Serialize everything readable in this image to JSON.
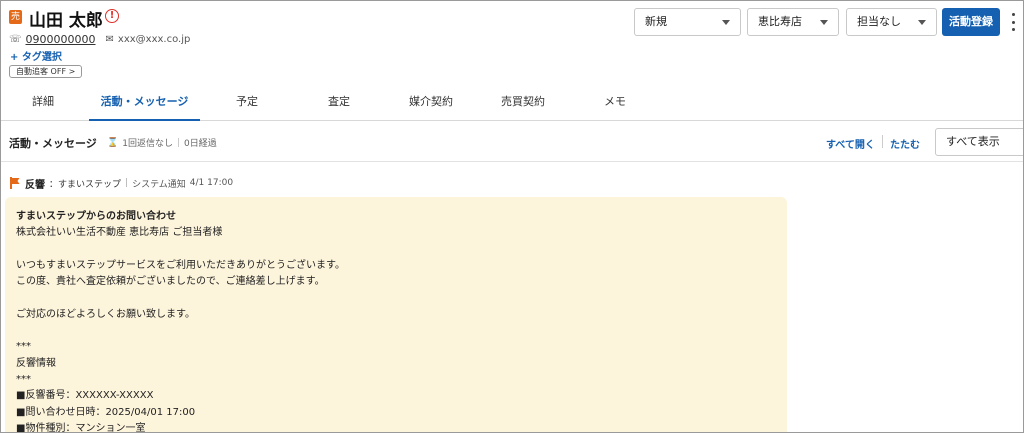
{
  "customer": {
    "badge": "売",
    "name": "山田 太郎",
    "alert_glyph": "!",
    "phone": "0900000000",
    "email": "xxx@xxx.co.jp",
    "tag_select": "+ タグ選択",
    "auto_chase_chip": "自動追客 OFF >"
  },
  "toolbar": {
    "status_select": "新規",
    "store_select": "恵比寿店",
    "assignee_select": "担当なし",
    "primary_button": "活動登録"
  },
  "tabs": [
    {
      "label": "詳細",
      "active": false
    },
    {
      "label": "活動・メッセージ",
      "active": true
    },
    {
      "label": "予定",
      "active": false
    },
    {
      "label": "査定",
      "active": false
    },
    {
      "label": "媒介契約",
      "active": false
    },
    {
      "label": "売買契約",
      "active": false
    },
    {
      "label": "メモ",
      "active": false
    }
  ],
  "section": {
    "title": "活動・メッセージ",
    "reply_status": "1回返信なし",
    "elapsed": "0日経過",
    "expand_all": "すべて開く",
    "collapse": "たたむ",
    "filter_select": "すべて表示"
  },
  "message": {
    "kind": "反響",
    "source": "：すまいステップ",
    "category": "システム通知",
    "timestamp": "4/1 17:00",
    "lines": [
      "すまいステップからのお問い合わせ",
      "株式会社いい生活不動産 恵比寿店 ご担当者様",
      "",
      "いつもすまいステップサービスをご利用いただきありがとうございます。",
      "この度、貴社へ査定依頼がございましたので、ご連絡差し上げます。",
      "",
      "ご対応のほどよろしくお願い致します。",
      "",
      "***",
      "反響情報",
      "***",
      "■反響番号：XXXXXX-XXXXX",
      "■問い合わせ日時：2025/04/01 17:00",
      "■物件種別：マンション一室"
    ]
  },
  "colors": {
    "accent": "#1560b0",
    "brand_orange": "#e46a1a",
    "alert_red": "#e0302a",
    "message_bg": "#fdf4dc"
  },
  "icons": {
    "phone": "phone-icon",
    "mail": "mail-icon",
    "hourglass": "hourglass-icon",
    "flag": "flag-icon",
    "alert": "alert-circle-icon",
    "more": "more-vertical-icon"
  }
}
